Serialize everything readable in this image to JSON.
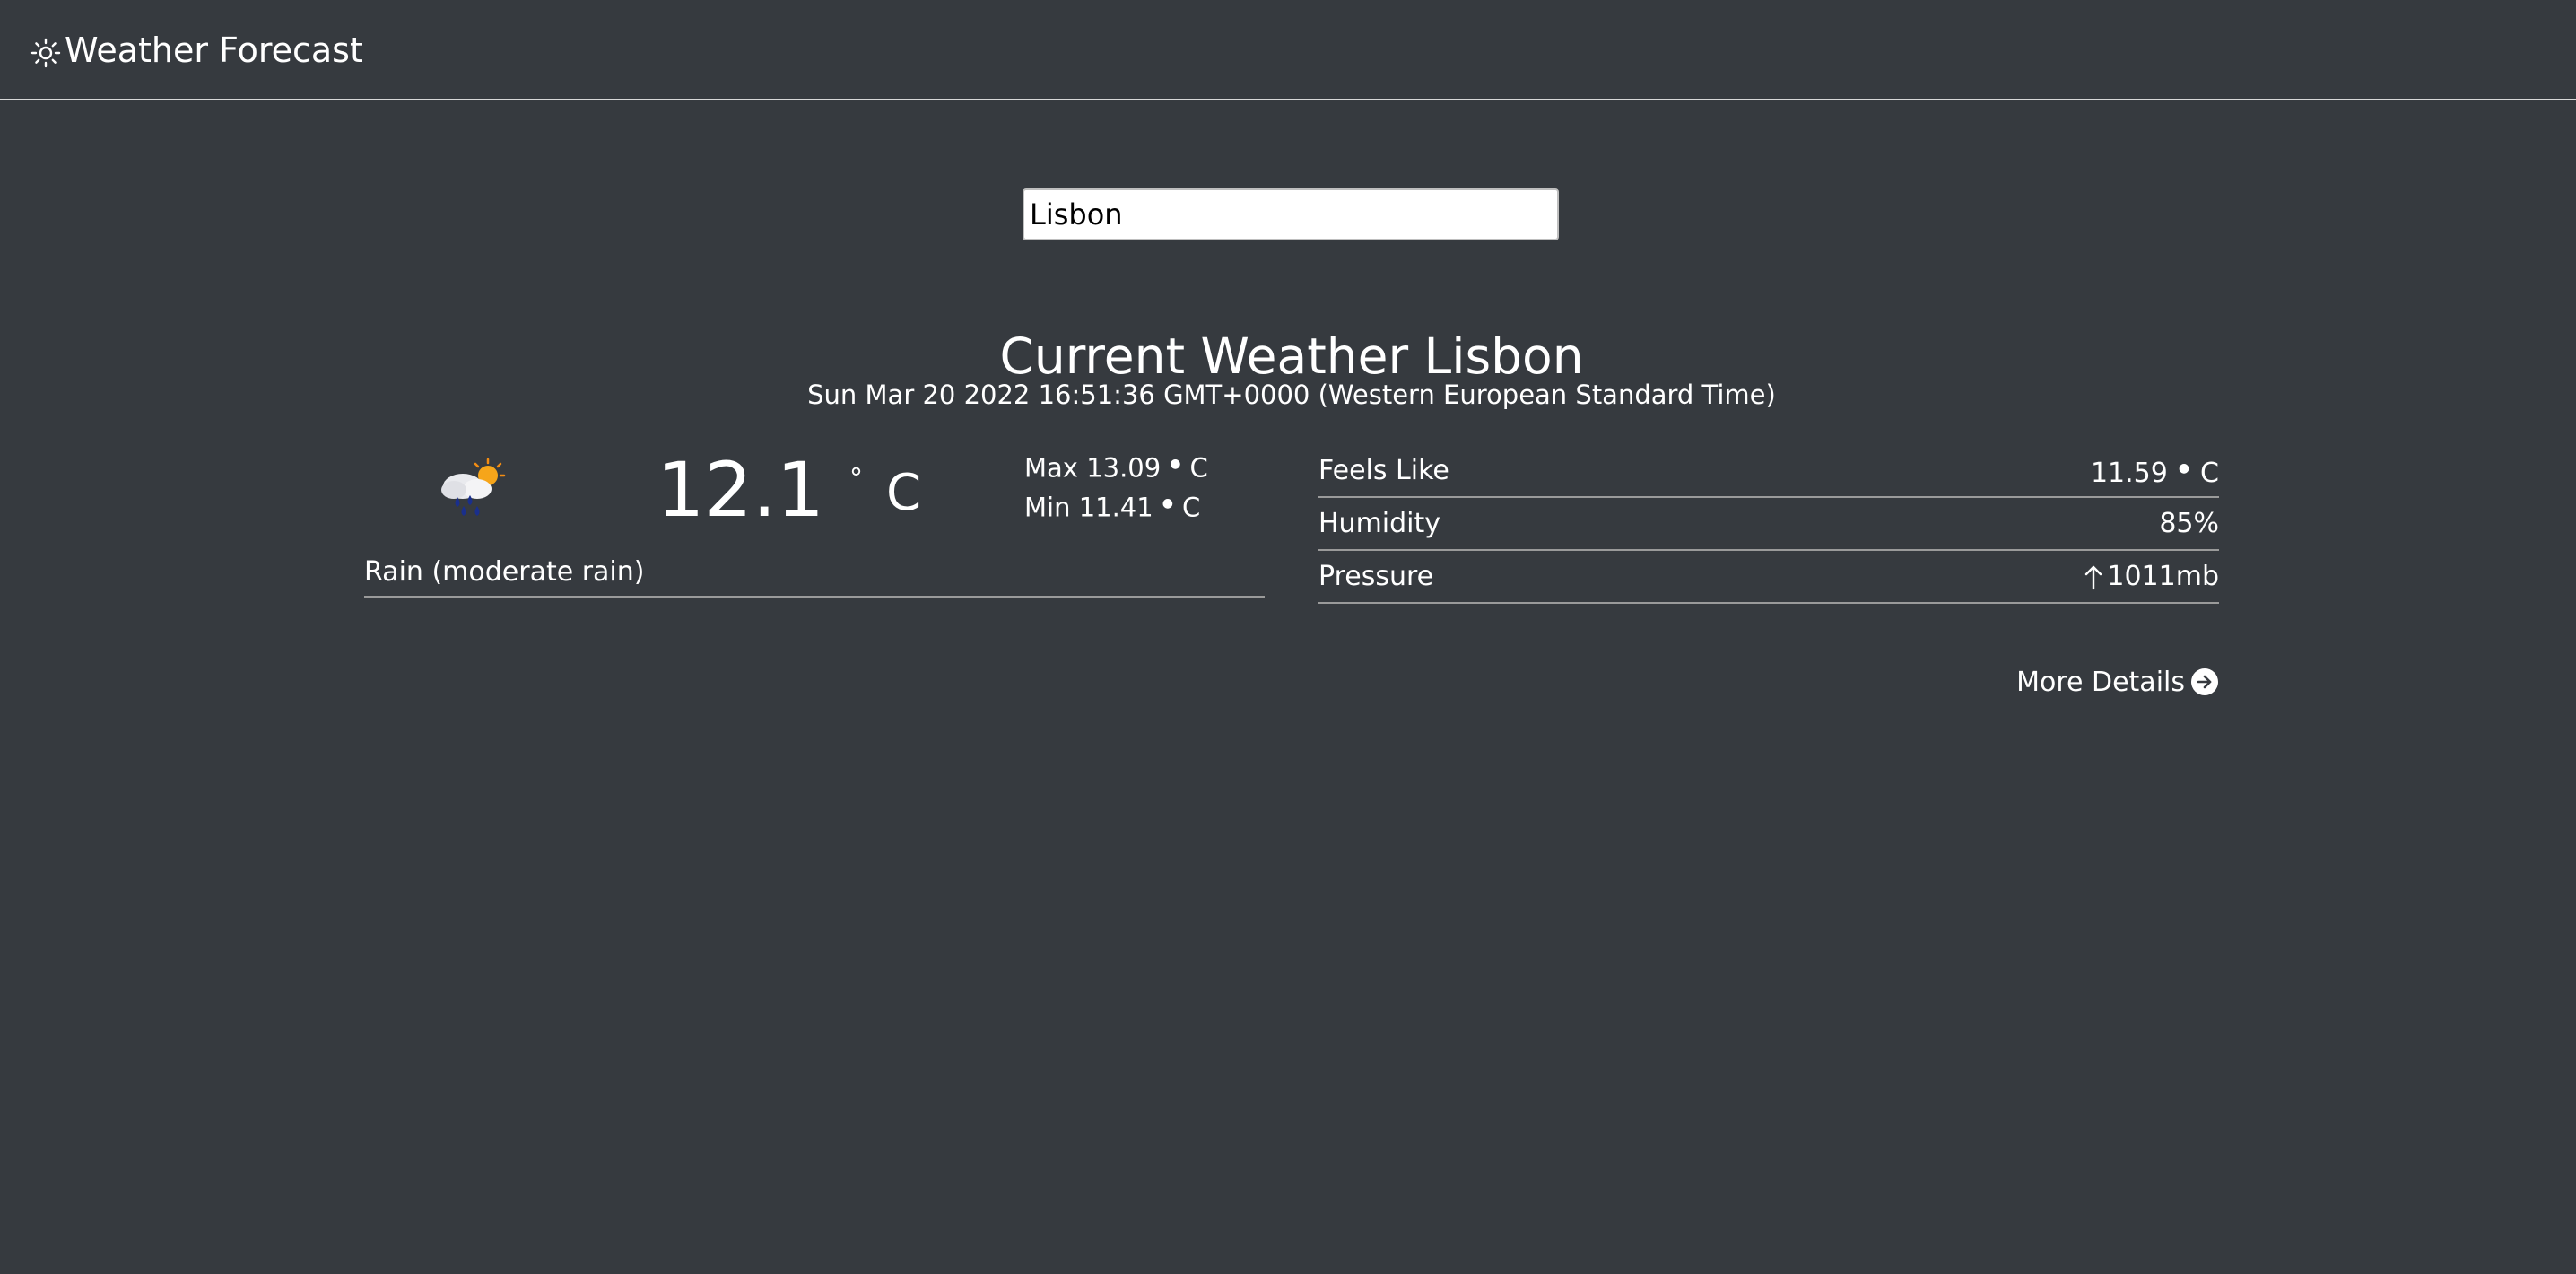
{
  "navbar": {
    "brand": "Weather Forecast",
    "brand_icon": "sun-icon"
  },
  "search": {
    "value": "Lisbon"
  },
  "current": {
    "title": "Current Weather Lisbon",
    "datetime": "Sun Mar 20 2022 16:51:36 GMT+0000 (Western European Standard Time)",
    "icon": "rain-cloud-sun-icon",
    "temp": "12.1",
    "degree_symbol": "°",
    "unit": "C",
    "max_label": "Max",
    "max_value": "13.09",
    "min_label": "Min",
    "min_value": "11.41",
    "description": "Rain (moderate rain)"
  },
  "details": {
    "feels_like_label": "Feels Like",
    "feels_like_value": "11.59",
    "humidity_label": "Humidity",
    "humidity_value": "85%",
    "pressure_label": "Pressure",
    "pressure_value": "1011mb",
    "pressure_icon": "arrow-up-icon"
  },
  "more_details": {
    "label": "More Details",
    "icon": "arrow-right-circle-icon"
  }
}
